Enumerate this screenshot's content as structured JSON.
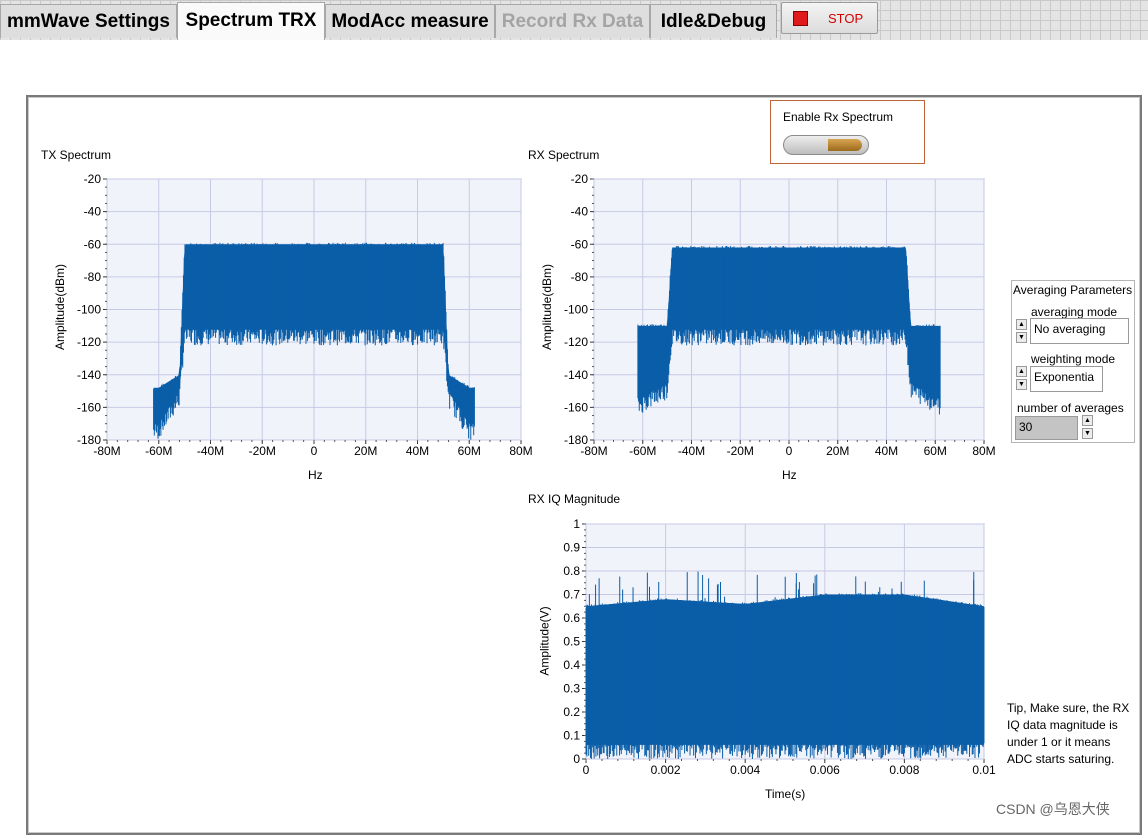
{
  "tabs": [
    {
      "label": "mmWave Settings",
      "state": "normal"
    },
    {
      "label": "Spectrum TRX",
      "state": "active"
    },
    {
      "label": "ModAcc measure",
      "state": "normal"
    },
    {
      "label": "Record Rx Data",
      "state": "disabled"
    },
    {
      "label": "Idle&Debug",
      "state": "normal"
    }
  ],
  "stop_button": {
    "label": "STOP",
    "icon": "stop-square-icon",
    "color": "#e01a1a"
  },
  "enable_rx": {
    "label": "Enable Rx Spectrum",
    "value": true
  },
  "accent_color": "#0b5ea8",
  "tx_spectrum": {
    "title": "TX Spectrum",
    "ylabel": "Amplitude(dBm)",
    "xlabel": "Hz",
    "yticks": [
      "-20",
      "-40",
      "-60",
      "-80",
      "-100",
      "-120",
      "-140",
      "-160",
      "-180"
    ],
    "xticks": [
      "-80M",
      "-60M",
      "-40M",
      "-20M",
      "0",
      "20M",
      "40M",
      "60M",
      "80M"
    ]
  },
  "rx_spectrum": {
    "title": "RX Spectrum",
    "ylabel": "Amplitude(dBm)",
    "xlabel": "Hz",
    "yticks": [
      "-20",
      "-40",
      "-60",
      "-80",
      "-100",
      "-120",
      "-140",
      "-160",
      "-180"
    ],
    "xticks": [
      "-80M",
      "-60M",
      "-40M",
      "-20M",
      "0",
      "20M",
      "40M",
      "60M",
      "80M"
    ]
  },
  "rx_iq": {
    "title": "RX IQ Magnitude",
    "ylabel": "Amplitude(V)",
    "xlabel": "Time(s)",
    "yticks": [
      "1",
      "0.9",
      "0.8",
      "0.7",
      "0.6",
      "0.5",
      "0.4",
      "0.3",
      "0.2",
      "0.1",
      "0"
    ],
    "xticks": [
      "0",
      "0.002",
      "0.004",
      "0.006",
      "0.008",
      "0.01"
    ]
  },
  "chart_data": [
    {
      "type": "area",
      "name": "TX Spectrum",
      "x_unit": "Hz",
      "y_unit": "dBm",
      "xlim": [
        -80000000,
        80000000
      ],
      "ylim": [
        -180,
        -20
      ],
      "x": [
        -62000000,
        -60000000,
        -52000000,
        -50000000,
        -48000000,
        0,
        48000000,
        50000000,
        52000000,
        60000000,
        62000000
      ],
      "upper": [
        -148,
        -148,
        -140,
        -60,
        -60,
        -60,
        -60,
        -60,
        -140,
        -148,
        -148
      ],
      "lower": [
        -180,
        -180,
        -160,
        -122,
        -122,
        -122,
        -122,
        -122,
        -160,
        -180,
        -180
      ]
    },
    {
      "type": "area",
      "name": "RX Spectrum",
      "x_unit": "Hz",
      "y_unit": "dBm",
      "xlim": [
        -80000000,
        80000000
      ],
      "ylim": [
        -180,
        -20
      ],
      "x": [
        -62000000,
        -50000000,
        -48000000,
        0,
        48000000,
        50000000,
        62000000
      ],
      "upper": [
        -110,
        -110,
        -62,
        -62,
        -62,
        -110,
        -110
      ],
      "lower": [
        -165,
        -155,
        -122,
        -122,
        -122,
        -155,
        -165
      ]
    },
    {
      "type": "area",
      "name": "RX IQ Magnitude",
      "x_unit": "s",
      "y_unit": "V",
      "xlim": [
        0,
        0.01
      ],
      "ylim": [
        0,
        1
      ],
      "x": [
        0,
        0.002,
        0.004,
        0.006,
        0.008,
        0.01
      ],
      "upper": [
        0.65,
        0.68,
        0.66,
        0.7,
        0.7,
        0.65
      ],
      "peak": 0.81,
      "lower": [
        0,
        0,
        0,
        0,
        0,
        0
      ]
    }
  ],
  "averaging": {
    "title": "Averaging Parameters",
    "mode_label": "averaging mode",
    "mode_value": "No averaging",
    "weight_label": "weighting mode",
    "weight_value": "Exponentia",
    "count_label": "number of averages",
    "count_value": "30"
  },
  "tip": "Tip, Make sure, the RX IQ data magnitude is under 1 or it means ADC starts saturing.",
  "watermark": "CSDN @乌恩大侠"
}
